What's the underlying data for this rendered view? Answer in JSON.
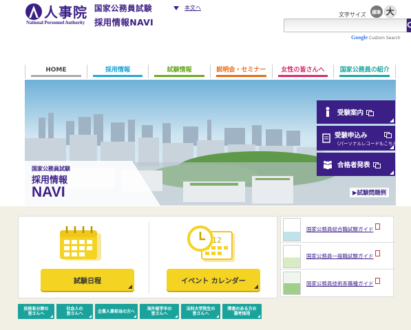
{
  "header": {
    "logo_text": "人事院",
    "logo_en": "National Personnel Authority",
    "site_title_line1": "国家公務員試験",
    "site_title_line2": "採用情報NAVI",
    "skip_link": "本文へ",
    "fontsize_label": "文字サイズ",
    "fontsize_normal": "標準",
    "fontsize_large": "大",
    "search_placeholder": "",
    "google_label": "Google",
    "google_sub": "Custom Search"
  },
  "nav": {
    "items": [
      {
        "label": "HOME"
      },
      {
        "label": "採用情報"
      },
      {
        "label": "試験情報"
      },
      {
        "label": "説明会・セミナー"
      },
      {
        "label": "女性の皆さんへ"
      },
      {
        "label": "国家公務員の紹介"
      }
    ]
  },
  "hero": {
    "title_line1": "国家公務員試験",
    "title_line2": "採用情報",
    "title_line3": "NAVI",
    "buttons": [
      {
        "label": "受験案内",
        "sub": ""
      },
      {
        "label": "受験申込み",
        "sub": "（パーソナルレコードもこちら）"
      },
      {
        "label": "合格者発表",
        "sub": ""
      }
    ],
    "link": "▶試験問題例"
  },
  "calendar": {
    "exam_schedule": "試験日程",
    "event_calendar": "イベント カレンダー",
    "calendar_number": "12"
  },
  "guides": [
    {
      "label": "国家公務員総合職試験ガイド"
    },
    {
      "label": "国家公務員一般職試験ガイド"
    },
    {
      "label": "国家公務員技術系職種ガイド"
    }
  ],
  "tags": [
    {
      "label": "技術系分野の\n皆さんへ"
    },
    {
      "label": "社会人の\n皆さんへ"
    },
    {
      "label": "企業人事担当の方へ"
    },
    {
      "label": "海外留学中の\n皆さんへ"
    },
    {
      "label": "法科大学院生の\n皆さんへ"
    },
    {
      "label": "障害のある方の\n選考採用"
    }
  ],
  "colors": {
    "brand": "#3b1f86",
    "accent_yellow": "#f5d322",
    "tag_teal": "#1aa39c"
  }
}
